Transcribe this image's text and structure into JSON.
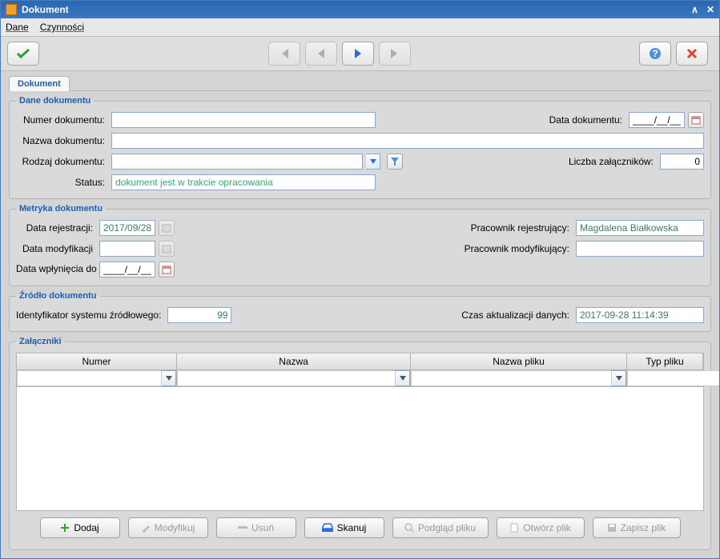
{
  "title": "Dokument",
  "menu": {
    "dane": "Dane",
    "czynnosci": "Czynności"
  },
  "tab": "Dokument",
  "sec1": {
    "legend": "Dane dokumentu",
    "numer_lbl": "Numer dokumentu:",
    "numer": "",
    "data_dok_lbl": "Data dokumentu:",
    "data_dok": "____/__/__",
    "nazwa_lbl": "Nazwa dokumentu:",
    "nazwa": "",
    "rodzaj_lbl": "Rodzaj dokumentu:",
    "rodzaj": "",
    "liczba_lbl": "Liczba załączników:",
    "liczba": "0",
    "status_lbl": "Status:",
    "status": "dokument jest w trakcie opracowania"
  },
  "sec2": {
    "legend": "Metryka dokumentu",
    "data_rej_lbl": "Data rejestracji:",
    "data_rej": "2017/09/28",
    "prac_rej_lbl": "Pracownik rejestrujący:",
    "prac_rej": "Magdalena Białkowska",
    "data_mod_lbl": "Data modyfikacji",
    "data_mod": "",
    "prac_mod_lbl": "Pracownik modyfikujący:",
    "prac_mod": "",
    "data_arch_lbl": "Data wpłynięcia do archiwum",
    "data_arch": "____/__/__"
  },
  "sec3": {
    "legend": "Źródło dokumentu",
    "id_lbl": "Identyfikator systemu źródłowego:",
    "id": "99",
    "czas_lbl": "Czas aktualizacji danych:",
    "czas": "2017-09-28 11:14:39"
  },
  "sec4": {
    "legend": "Załączniki",
    "cols": {
      "numer": "Numer",
      "nazwa": "Nazwa",
      "nazwa_pliku": "Nazwa pliku",
      "typ": "Typ pliku"
    }
  },
  "buttons": {
    "dodaj": "Dodaj",
    "modyfikuj": "Modyfikuj",
    "usun": "Usuń",
    "skanuj": "Skanuj",
    "podglad": "Podgląd pliku",
    "otworz": "Otwórz plik",
    "zapisz": "Zapisz plik"
  }
}
